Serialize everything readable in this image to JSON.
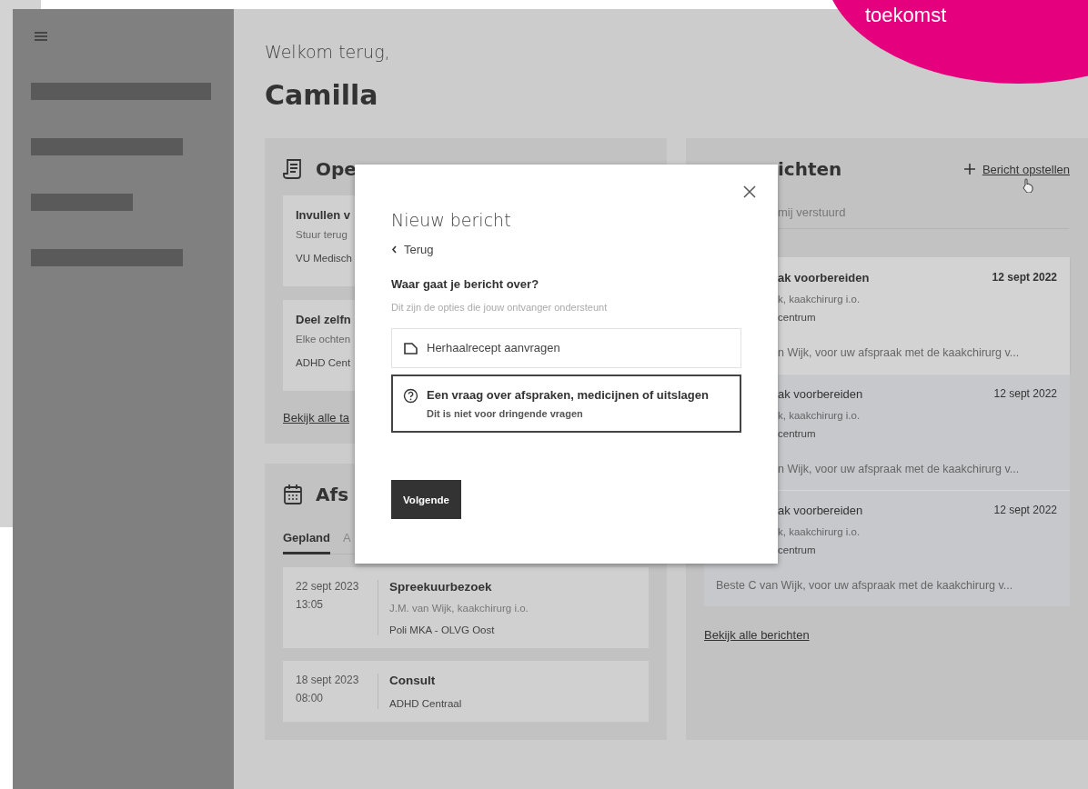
{
  "corner_badge": {
    "text": "toekomst"
  },
  "greeting": {
    "line": "Welkom terug,",
    "name": "Camilla"
  },
  "tasks_panel": {
    "title": "Ope",
    "cards": [
      {
        "title": "Invullen v",
        "subtitle": "Stuur terug",
        "source": "VU Medisch"
      },
      {
        "title": "Deel zelfn",
        "subtitle": "Elke ochten",
        "source": "ADHD Cent"
      }
    ],
    "link": "Bekijk alle ta"
  },
  "appointments_panel": {
    "title": "Afs",
    "tabs": [
      {
        "label": "Gepland",
        "selected": true
      },
      {
        "label": "A",
        "selected": false
      }
    ],
    "appointments": [
      {
        "date": "22 sept 2023",
        "time": "13:05",
        "title": "Spreekuurbezoek",
        "person": "J.M. van Wijk, kaakchirurg i.o.",
        "place": "Poli MKA - OLVG Oost"
      },
      {
        "date": "18 sept 2023",
        "time": "08:00",
        "title": "Consult",
        "place": "ADHD Centraal"
      }
    ]
  },
  "messages_panel": {
    "title": "ichten",
    "compose": "Bericht opstellen",
    "filter": "mij verstuurd",
    "messages": [
      {
        "title": "ak voorbereiden",
        "date": "12 sept 2022",
        "sender": "k, kaakchirurg i.o.",
        "place": "centrum",
        "preview": "n Wijk, voor uw afspraak met de kaakchirurg v...",
        "unread": true
      },
      {
        "title": "ak voorbereiden",
        "date": "12 sept 2022",
        "sender": "k, kaakchirurg i.o.",
        "place": "centrum",
        "preview": "n Wijk, voor uw afspraak met de kaakchirurg v...",
        "unread": false
      },
      {
        "title": "ak voorbereiden",
        "date": "12 sept 2022",
        "sender": "k, kaakchirurg i.o.",
        "place": "centrum",
        "preview": "Beste C van Wijk, voor uw afspraak met de kaakchirurg v...",
        "unread": false
      }
    ],
    "link": "Bekijk alle berichten"
  },
  "dialog": {
    "title": "Nieuw bericht",
    "back": "Terug",
    "question": "Waar gaat je bericht over?",
    "hint": "Dit zijn de opties die jouw ontvanger ondersteunt",
    "options": [
      {
        "kind": "document",
        "label": "Herhaalrecept aanvragen",
        "selected": false
      },
      {
        "kind": "question",
        "label": "Een vraag over afspraken, medicijnen of uitslagen",
        "description": "Dit is niet voor dringende vragen",
        "selected": true
      }
    ],
    "button": "Volgende"
  }
}
